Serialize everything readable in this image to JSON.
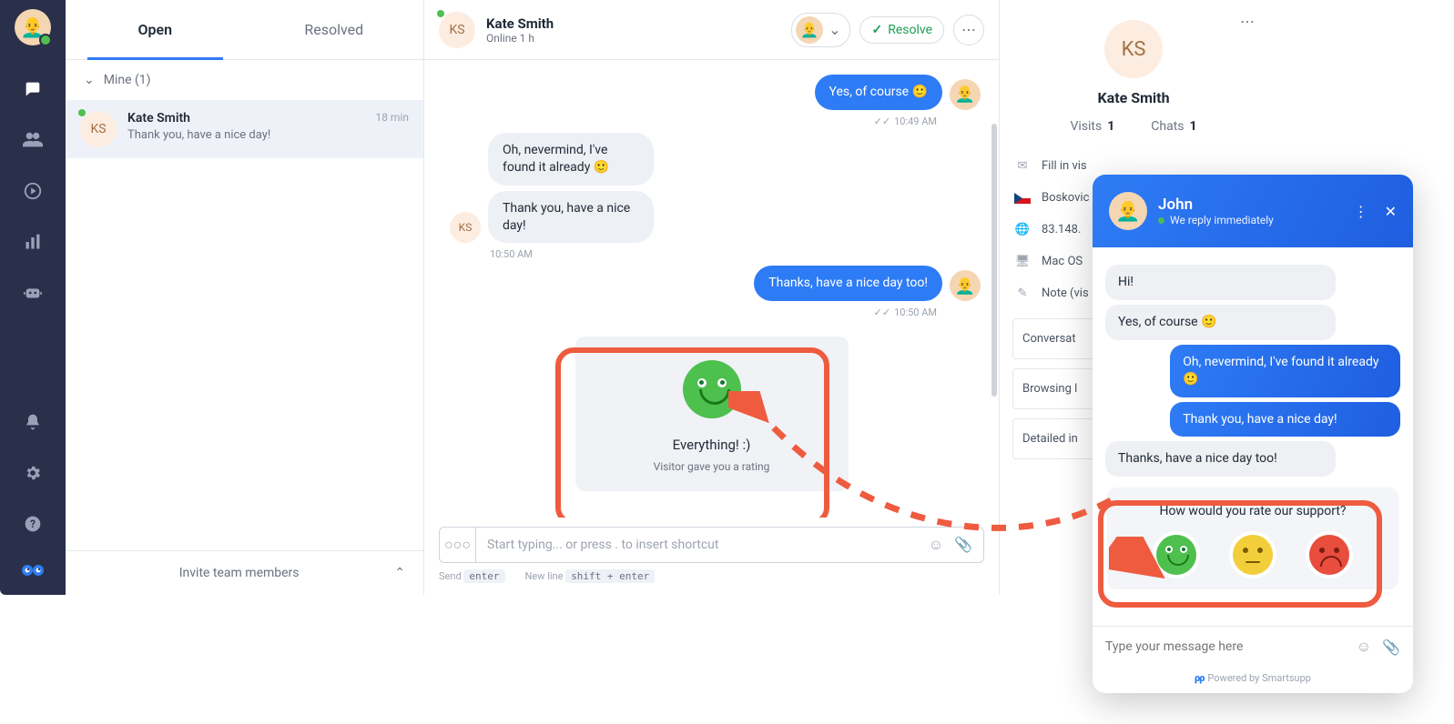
{
  "nav": {
    "avatar_emoji": "👨‍🦲"
  },
  "tabs": {
    "open": "Open",
    "resolved": "Resolved"
  },
  "listSection": {
    "label": "Mine (1)"
  },
  "conversation": {
    "name": "Kate Smith",
    "preview": "Thank you, have a nice day!",
    "time": "18 min",
    "initials": "KS"
  },
  "invite": {
    "label": "Invite team members"
  },
  "chatHeader": {
    "initials": "KS",
    "title": "Kate Smith",
    "status": "Online 1 h",
    "resolve": "Resolve"
  },
  "messages": {
    "agent1": "Yes, of course 🙂",
    "ts1": "10:49 AM",
    "visitor1": "Oh, nevermind, I've found it already 🙂",
    "visitor2": "Thank you, have a nice day!",
    "ts2": "10:50 AM",
    "agent2": "Thanks, have a nice day too!",
    "ts3": "10:50 AM",
    "visitorInitials": "KS"
  },
  "rating": {
    "text": "Everything! :)",
    "sub": "Visitor gave you a rating"
  },
  "compose": {
    "placeholder": "Start typing... or press . to insert shortcut",
    "sendHint": "Send",
    "sendKey": "enter",
    "newlineHint": "New line",
    "newlineKey": "shift + enter"
  },
  "details": {
    "initials": "KS",
    "name": "Kate Smith",
    "visitsLabel": "Visits",
    "visitsCount": "1",
    "chatsLabel": "Chats",
    "chatsCount": "1",
    "email": "Fill in vis",
    "location": "Boskovic",
    "ip": "83.148.",
    "os": "Mac OS",
    "note": "Note (vis",
    "sectionConversation": "Conversat",
    "sectionBrowsing": "Browsing l",
    "sectionDetailed": "Detailed in"
  },
  "widget": {
    "agentName": "John",
    "status": "We reply immediately",
    "msgs": {
      "left1": "Hi!",
      "left2": "Yes, of course 🙂",
      "right1": "Oh, nevermind, I've found it already 🙂",
      "right2": "Thank you, have a nice day!",
      "left3": "Thanks, have a nice day too!"
    },
    "rateQuestion": "How would you rate our support?",
    "inputPlaceholder": "Type your message here",
    "powered": "Powered by Smartsupp"
  }
}
